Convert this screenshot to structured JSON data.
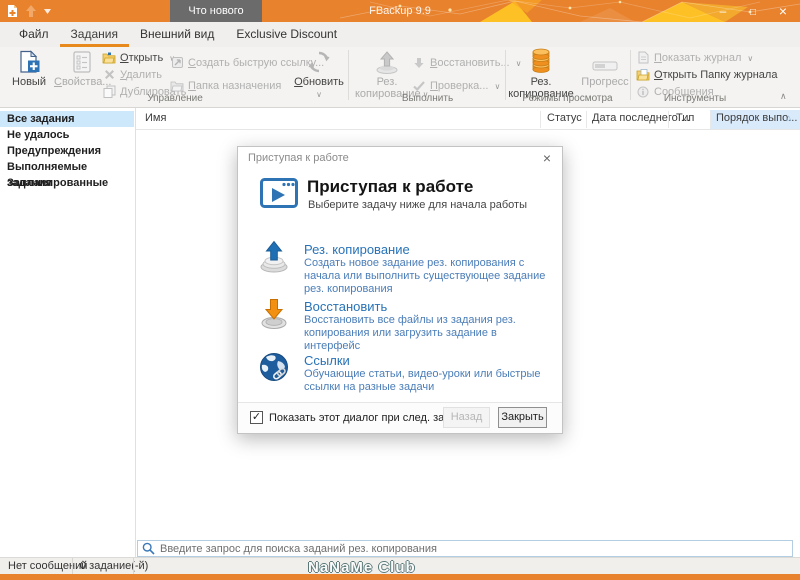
{
  "titlebar": {
    "title": "FBackup 9.9",
    "whats_new": "Что нового"
  },
  "tabs": {
    "items": [
      {
        "label": "Файл"
      },
      {
        "label": "Задания",
        "active": true
      },
      {
        "label": "Внешний вид"
      },
      {
        "label": "Exclusive Discount"
      }
    ]
  },
  "ribbon": {
    "management": {
      "label": "Управление",
      "new": "Новый",
      "properties": "Свойства...",
      "open": "Открыть",
      "delete": "Удалить",
      "duplicate": "Дублировать",
      "quick_shortcut": "Создать быструю ссылку...",
      "destination": "Папка назначения",
      "refresh": "Обновить"
    },
    "execute": {
      "label": "Выполнить",
      "backup": "Рез. копирование",
      "restore": "Восстановить...",
      "test": "Проверка..."
    },
    "view_modes": {
      "label": "Режимы просмотра",
      "backup": "Рез. копирование",
      "progress": "Прогресс"
    },
    "tools": {
      "label": "Инструменты",
      "show_log": "Показать журнал",
      "open_log_folder": "Открыть Папку журнала",
      "messages": "Сообщения"
    }
  },
  "sidebar": {
    "items": [
      {
        "label": "Все задания",
        "selected": true
      },
      {
        "label": "Не удалось"
      },
      {
        "label": "Предупреждения"
      },
      {
        "label": "Выполняемые задания"
      },
      {
        "label": "Запланированные"
      }
    ]
  },
  "table": {
    "columns": [
      "Имя",
      "Статус",
      "Дата последнего ...",
      "Тип",
      "Порядок выпо..."
    ]
  },
  "search": {
    "placeholder": "Введите запрос для поиска заданий рез. копирования"
  },
  "statusbar": {
    "messages": "Нет сообщений",
    "tasks": "0 задание(-й)"
  },
  "watermark": "NaNaMe Club",
  "dialog": {
    "window_title": "Приступая к работе",
    "title": "Приступая к работе",
    "subtitle": "Выберите задачу ниже для начала работы",
    "items": [
      {
        "title": "Рез. копирование",
        "desc": "Создать новое задание рез. копирования с начала или выполнить существующее задание рез. копирования"
      },
      {
        "title": "Восстановить",
        "desc": "Восстановить все файлы из задания рез. копирования или загрузить задание в интерфейс"
      },
      {
        "title": "Ссылки",
        "desc": "Обучающие статьи, видео-уроки или быстрые ссылки на разные задачи"
      }
    ],
    "checkbox_label": "Показать этот диалог при след. запуске",
    "back_button": "Назад",
    "close_button": "Закрыть"
  },
  "colors": {
    "accent_orange": "#e8822d",
    "tab_underline": "#e8891d",
    "link_blue": "#2873b8",
    "selection_blue": "#cde7fb"
  }
}
